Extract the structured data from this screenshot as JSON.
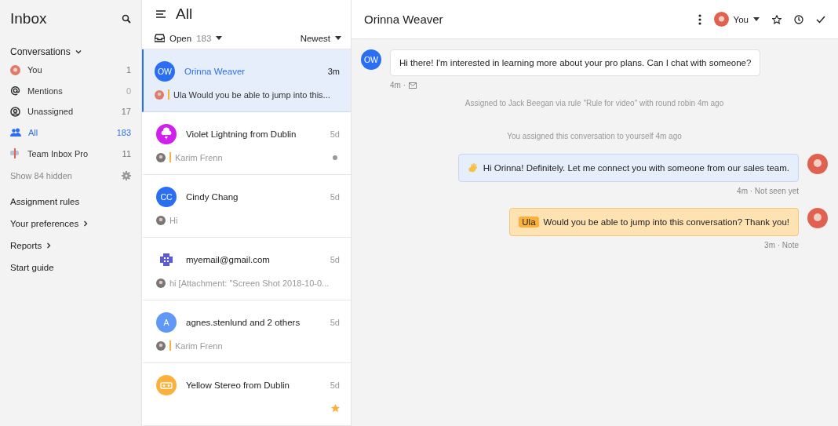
{
  "sidebar": {
    "title": "Inbox",
    "section": "Conversations",
    "items": [
      {
        "kind": "you",
        "label": "You",
        "count": "1",
        "selected": false,
        "muted": false
      },
      {
        "kind": "mentions",
        "label": "Mentions",
        "count": "0",
        "selected": false,
        "muted": true
      },
      {
        "kind": "unassigned",
        "label": "Unassigned",
        "count": "17",
        "selected": false,
        "muted": false
      },
      {
        "kind": "all",
        "label": "All",
        "count": "183",
        "selected": true,
        "muted": false
      },
      {
        "kind": "team",
        "label": "Team Inbox Pro",
        "count": "11",
        "selected": false,
        "muted": false
      }
    ],
    "hidden_link": "Show 84 hidden",
    "links": [
      {
        "label": "Assignment rules",
        "chevron": false
      },
      {
        "label": "Your preferences",
        "chevron": true
      },
      {
        "label": "Reports",
        "chevron": true
      },
      {
        "label": "Start guide",
        "chevron": false
      }
    ]
  },
  "list": {
    "title": "All",
    "status": "Open",
    "status_count": "183",
    "sort": "Newest",
    "conversations": [
      {
        "kind": "initials",
        "initials": "OW",
        "color": "#2a6ff3",
        "name": "Orinna Weaver",
        "time": "3m",
        "preview": "Ula Would you be able to jump into this...",
        "note": true,
        "unread": false,
        "starred": false,
        "selected": true
      },
      {
        "kind": "cloud",
        "color": "#d31ef0",
        "name": "Violet Lightning from Dublin",
        "time": "5d",
        "preview": "Karim Frenn",
        "note": true,
        "unread": true,
        "starred": false,
        "selected": false
      },
      {
        "kind": "initials",
        "initials": "CC",
        "color": "#2a6ff3",
        "name": "Cindy Chang",
        "time": "5d",
        "preview": "Hi",
        "note": false,
        "unread": false,
        "starred": false,
        "selected": false
      },
      {
        "kind": "pattern",
        "color": "#5b5bd6",
        "name": "myemail@gmail.com",
        "time": "5d",
        "preview": "hi [Attachment: \"Screen Shot 2018-10-0...",
        "note": false,
        "unread": false,
        "starred": false,
        "selected": false
      },
      {
        "kind": "initials",
        "initials": "A",
        "color": "#5f98f5",
        "name": "agnes.stenlund and 2 others",
        "time": "5d",
        "preview": "Karim Frenn",
        "note": true,
        "unread": false,
        "starred": false,
        "selected": false
      },
      {
        "kind": "stereo",
        "color": "#fbb03b",
        "name": "Yellow Stereo from Dublin",
        "time": "5d",
        "note": false,
        "unread": false,
        "starred": true,
        "selected": false
      }
    ]
  },
  "conversation": {
    "title": "Orinna Weaver",
    "assignee": "You",
    "messages": [
      {
        "kind": "incoming",
        "initials": "OW",
        "text": "Hi there! I'm interested in learning more about your pro plans. Can I chat with someone?",
        "meta": "4m ·"
      },
      {
        "kind": "event",
        "text": "Assigned to Jack Beegan via rule \"Rule for video\" with round robin 4m ago"
      },
      {
        "kind": "event",
        "text": "You assigned this conversation to yourself 4m ago"
      },
      {
        "kind": "outgoing",
        "text": "Hi Orinna! Definitely. Let me connect you with someone from our sales team.",
        "meta": "4m · Not seen yet"
      },
      {
        "kind": "note",
        "mention": "Ula",
        "text": "Would you be able to jump into this conversation? Thank you!",
        "meta": "3m · Note"
      }
    ]
  }
}
